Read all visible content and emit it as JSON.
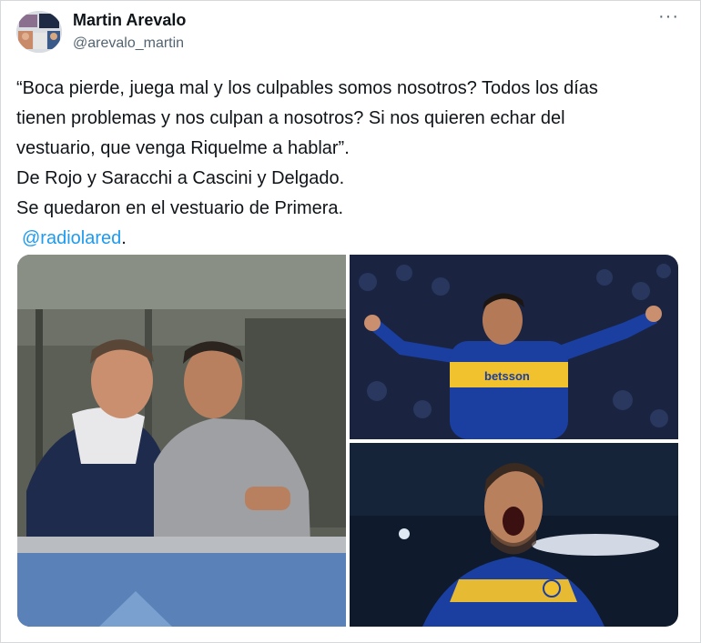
{
  "author": {
    "name": "Martin Arevalo",
    "handle": "@arevalo_martin"
  },
  "more_icon": "ellipsis-icon",
  "tweet": {
    "lines": [
      "“Boca pierde, juega mal y los culpables somos nosotros? Todos los días",
      "tienen problemas y nos culpan a nosotros? Si nos quieren echar del",
      "vestuario, que venga Riquelme a hablar”.",
      "De Rojo y Saracchi a Cascini y Delgado.",
      "Se quedaron en el vestuario de Primera."
    ],
    "mention": "@radiolared",
    "mention_suffix": "."
  },
  "photos": {
    "shirt_sponsor": "betsson"
  },
  "colors": {
    "mention": "#1d9bf0",
    "boca_blue": "#1a3fa0",
    "boca_gold": "#f2c12e"
  }
}
